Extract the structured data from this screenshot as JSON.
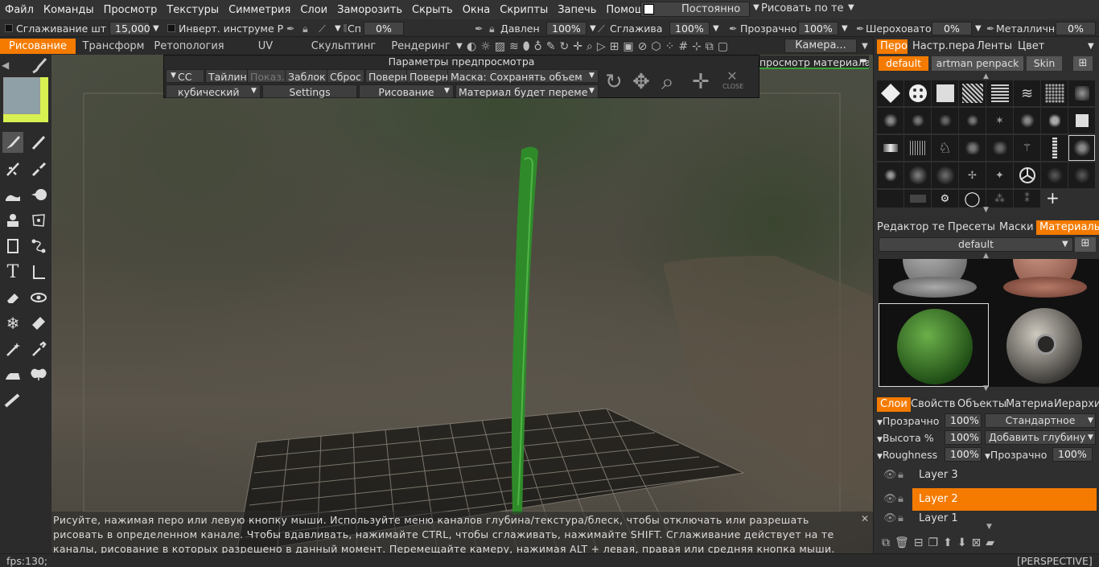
{
  "menu": [
    "Файл",
    "Команды",
    "Просмотр",
    "Текстуры",
    "Симметрия",
    "Слои",
    "Заморозить",
    "Скрыть",
    "Окна",
    "Скрипты",
    "Запечь",
    "Помощь"
  ],
  "menubar_right": {
    "mode": "Постоянно",
    "paint": "Рисовать по те"
  },
  "toolbar": {
    "smoothing_label": "Сглаживание шт",
    "smoothing_value": "15,000",
    "invert_label": "Инверт. инструме Р",
    "sp_label": "Сп",
    "sp_value": "0%",
    "pressure_label": "Давлен",
    "pressure_value": "100%",
    "smooth_label": "Сглажива",
    "smooth_value": "100%",
    "opacity_label": "Прозрачно",
    "opacity_value": "100%",
    "roughness_label": "Шероховато",
    "roughness_value": "0%",
    "metalness_label": "Металличнос",
    "metalness_value": "0%"
  },
  "tabs": [
    "Рисование",
    "Трансформ",
    "Ретопология",
    "UV",
    "Скульптинг",
    "Рендеринг"
  ],
  "camera_label": "Камера...",
  "preview": {
    "title": "Параметры предпросмотра",
    "row1": [
      "CC",
      "Тайлинг",
      "Показ.",
      "Заблок",
      "Сброс",
      "Поверн",
      "Поверн"
    ],
    "mask": "Маска: Сохранять объем",
    "row2_left": "кубический",
    "settings": "Settings",
    "paint": "Рисование",
    "material": "Материал будет переме",
    "close": "CLOSE",
    "mat_preview_label": "просмотр материала"
  },
  "hint": "Рисуйте, нажимая перо или левую кнопку мыши. Используйте меню каналов глубина/текстура/блеск, чтобы отключать или разрешать рисовать в определенном канале. Чтобы вдавливать, нажимайте CTRL, чтобы сглаживать, нажимайте SHIFT. Сглаживание действует на те каналы, рисование в которых разрешено в данный момент. Перемещайте камеру, нажимая ALT + левая, правая или средняя кнопка мыши.",
  "status": {
    "fps": "fps:130;",
    "view": "[PERSPECTIVE]"
  },
  "right": {
    "top_tabs": [
      "Перо",
      "Настр.пера",
      "Ленты",
      "Цвет"
    ],
    "pack_tabs": [
      "default",
      "artman penpack",
      "Skin"
    ],
    "mid_tabs": [
      "Редактор те",
      "Пресеты",
      "Маски",
      "Материалы"
    ],
    "material_set": "default",
    "layer_tabs": [
      "Слои",
      "Свойств",
      "Объекты",
      "Материа",
      "Иерархи"
    ],
    "props": [
      {
        "label": "Прозрачно",
        "value": "100%",
        "dd": "Стандартное"
      },
      {
        "label": "Высота %",
        "value": "100%",
        "dd": "Добавить глубину"
      },
      {
        "label": "Roughness",
        "value": "100%",
        "dd2_label": "Прозрачно",
        "dd2_value": "100%"
      }
    ],
    "layers": [
      "Layer 3",
      "Layer 2",
      "Layer 1"
    ]
  },
  "colors": {
    "accent": "#f47b00",
    "swatch": "#8fa1a6",
    "swatch2": "#d8f050"
  }
}
